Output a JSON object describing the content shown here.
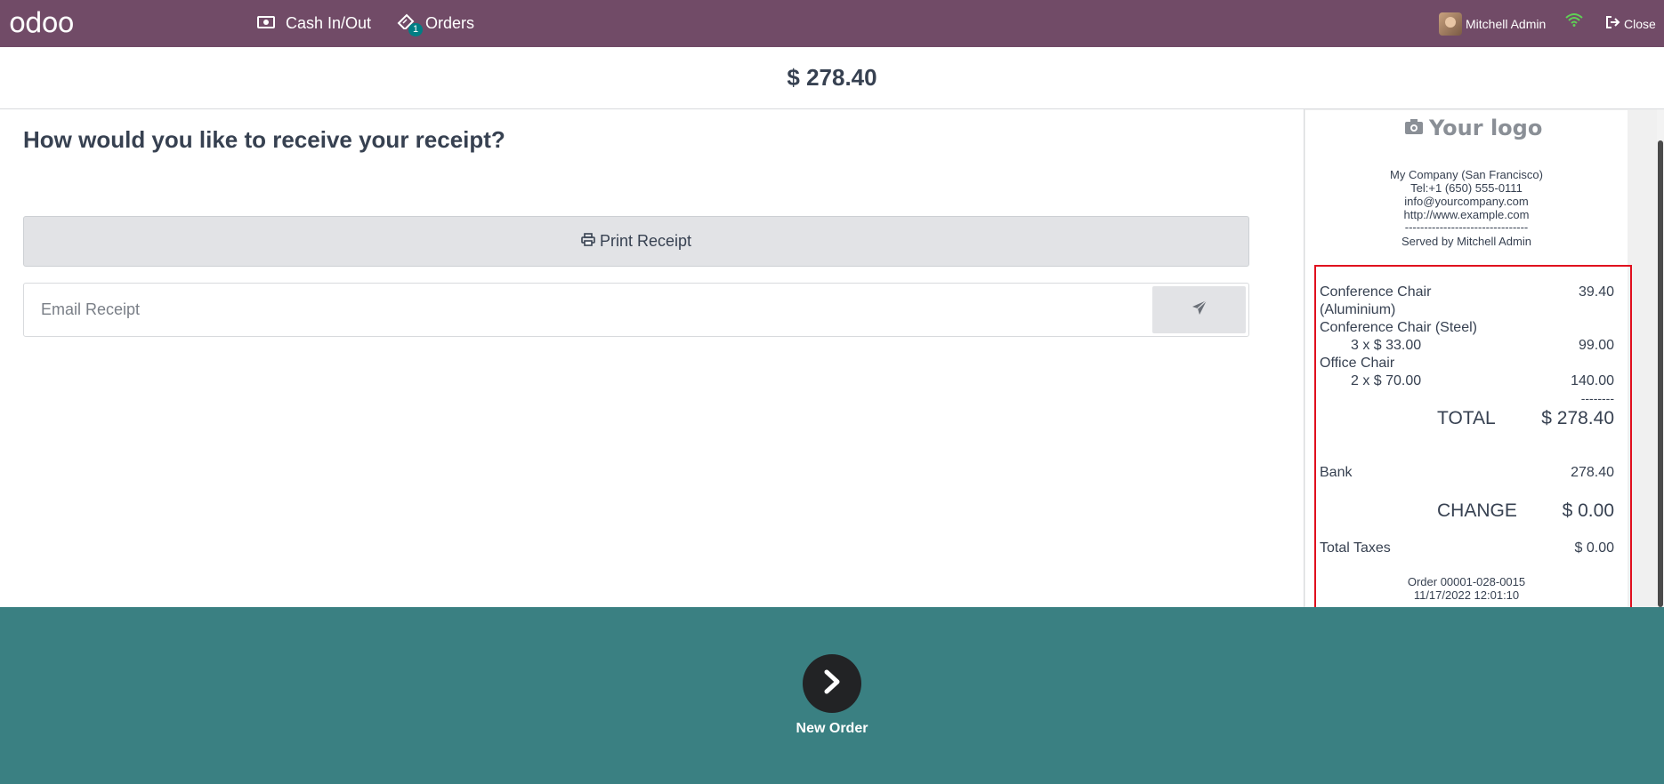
{
  "navbar": {
    "logo": "odoo",
    "cash_label": "Cash In/Out",
    "orders_label": "Orders",
    "orders_badge": "1",
    "user_name": "Mitchell Admin",
    "close_label": "Close",
    "bg_color": "#714B67"
  },
  "payment": {
    "amount": "$ 278.40",
    "question": "How would you like to receive your receipt?",
    "print_label": "Print Receipt",
    "email_placeholder": "Email Receipt"
  },
  "receipt": {
    "logo_text": "Your logo",
    "company": "My Company (San Francisco)",
    "tel": "Tel:+1 (650) 555-0111",
    "email": "info@yourcompany.com",
    "website": "http://www.example.com",
    "separator": "--------------------------------",
    "served_by": "Served by Mitchell Admin",
    "lines": [
      {
        "name_1": "Conference Chair",
        "name_2": "(Aluminium)",
        "qty": "",
        "price": "39.40"
      },
      {
        "name_1": "Conference Chair (Steel)",
        "name_2": "",
        "qty": "3 x $ 33.00",
        "price": "99.00"
      },
      {
        "name_1": "Office Chair",
        "name_2": "",
        "qty": "2 x $ 70.00",
        "price": "140.00"
      }
    ],
    "total_separator": "--------",
    "total_label": "TOTAL",
    "total_value": "$ 278.40",
    "payment_method": "Bank",
    "payment_amount": "278.40",
    "change_label": "CHANGE",
    "change_value": "$ 0.00",
    "taxes_label": "Total Taxes",
    "taxes_value": "$ 0.00",
    "order_ref": "Order 00001-028-0015",
    "order_date": "11/17/2022 12:01:10"
  },
  "footer": {
    "next_label": "New Order",
    "bg_color": "#3a8082"
  }
}
